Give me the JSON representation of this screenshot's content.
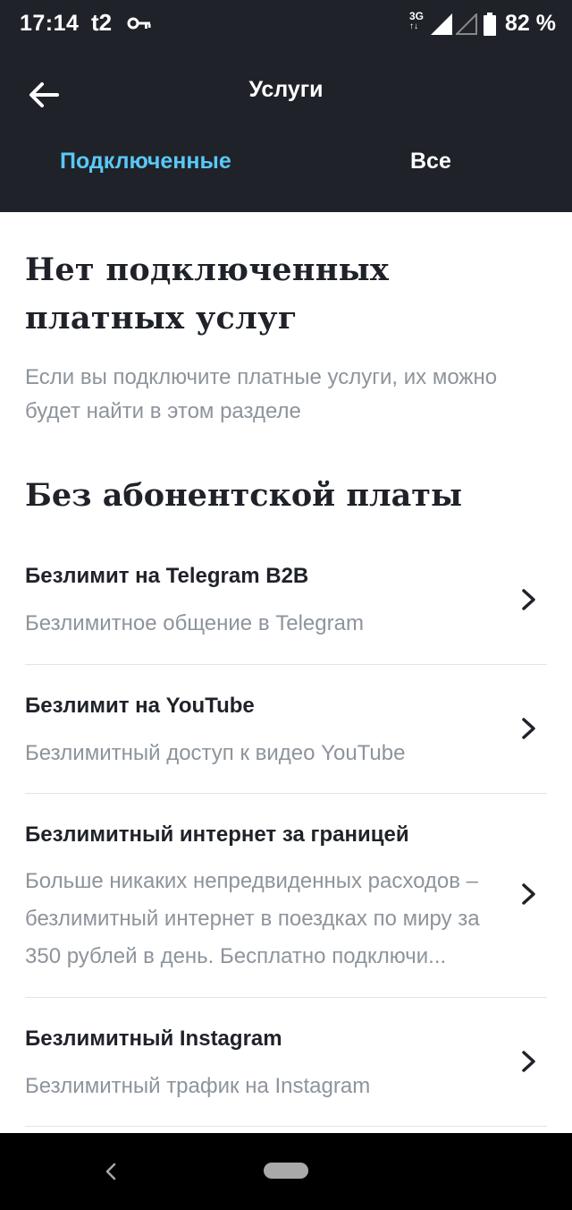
{
  "status_bar": {
    "time": "17:14",
    "carrier": "t2",
    "network_top": "3G",
    "network_bottom": "↑↓",
    "battery": "82 %",
    "icons": [
      "key-icon",
      "signal-icon",
      "signal-empty-icon",
      "battery-icon"
    ]
  },
  "header": {
    "title": "Услуги",
    "back_icon": "arrow-left-icon",
    "tabs": [
      {
        "label": "Подключенные",
        "active": true
      },
      {
        "label": "Все",
        "active": false
      }
    ],
    "colors": {
      "background": "#1f2229",
      "active_tab": "#5ac8f5"
    }
  },
  "main": {
    "empty_title": "Нет подключенных платных услуг",
    "empty_description": "Если вы подключите платные услуги, их можно будет найти в этом разделе",
    "section_title": "Без абонентской платы",
    "services": [
      {
        "title": "Безлимит на Telegram B2B",
        "subtitle": "Безлимитное общение в Telegram"
      },
      {
        "title": "Безлимит на YouTube",
        "subtitle": "Безлимитный доступ к видео YouTube"
      },
      {
        "title": "Безлимитный интернет за границей",
        "subtitle": "Больше никаких непредвиденных расходов – безлимитный интернет в поездках по миру за 350 рублей в день. Бесплатно подключи..."
      },
      {
        "title": "Безлимитный Instagram",
        "subtitle": "Безлимитный трафик на Instagram"
      }
    ]
  },
  "nav_bar": {
    "icons": [
      "nav-back-icon",
      "nav-home-pill"
    ]
  }
}
